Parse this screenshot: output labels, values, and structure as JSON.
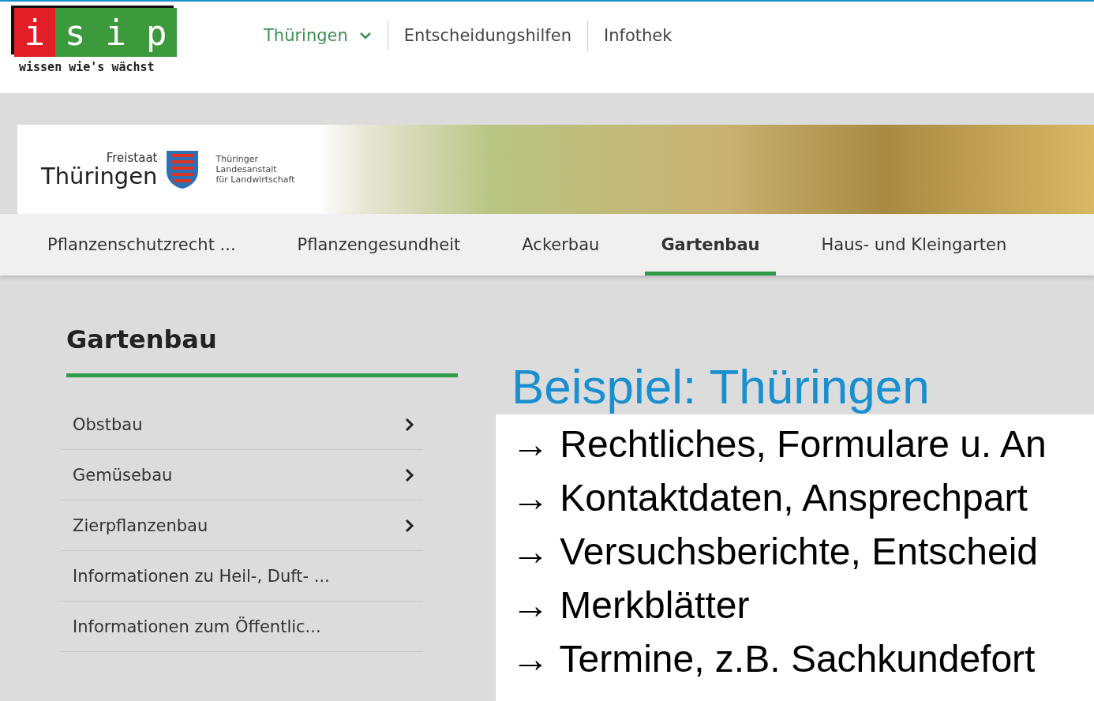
{
  "logo": {
    "letters": [
      "i",
      "s",
      "i",
      "p"
    ],
    "tagline": "wissen wie's wächst"
  },
  "top_nav": [
    {
      "label": "Thüringen",
      "selected": true,
      "dropdown": true
    },
    {
      "label": "Entscheidungshilfen",
      "selected": false,
      "dropdown": false
    },
    {
      "label": "Infothek",
      "selected": false,
      "dropdown": false
    }
  ],
  "banner": {
    "state_small": "Freistaat",
    "state_name": "Thüringen",
    "agency_lines": [
      "Thüringer",
      "Landesanstalt",
      "für Landwirtschaft"
    ]
  },
  "tabs": [
    {
      "label": "Pflanzenschutzrecht ...",
      "selected": false
    },
    {
      "label": "Pflanzengesundheit",
      "selected": false
    },
    {
      "label": "Ackerbau",
      "selected": false
    },
    {
      "label": "Gartenbau",
      "selected": true
    },
    {
      "label": "Haus- und Kleingarten",
      "selected": false
    }
  ],
  "sidebar": {
    "title": "Gartenbau",
    "items": [
      {
        "label": "Obstbau",
        "expandable": true
      },
      {
        "label": "Gemüsebau",
        "expandable": true
      },
      {
        "label": "Zierpflanzenbau",
        "expandable": true
      },
      {
        "label": "Informationen zu Heil-, Duft- ...",
        "expandable": false
      },
      {
        "label": "Informationen zum Öffentlic...",
        "expandable": false
      }
    ]
  },
  "slide": {
    "title": "Beispiel: Thüringen",
    "bullets": [
      "→ Rechtliches, Formulare u. An",
      "→ Kontaktdaten, Ansprechpart",
      "→ Versuchsberichte, Entscheid",
      "→ Merkblätter",
      "→ Termine, z.B. Sachkundefort"
    ]
  }
}
